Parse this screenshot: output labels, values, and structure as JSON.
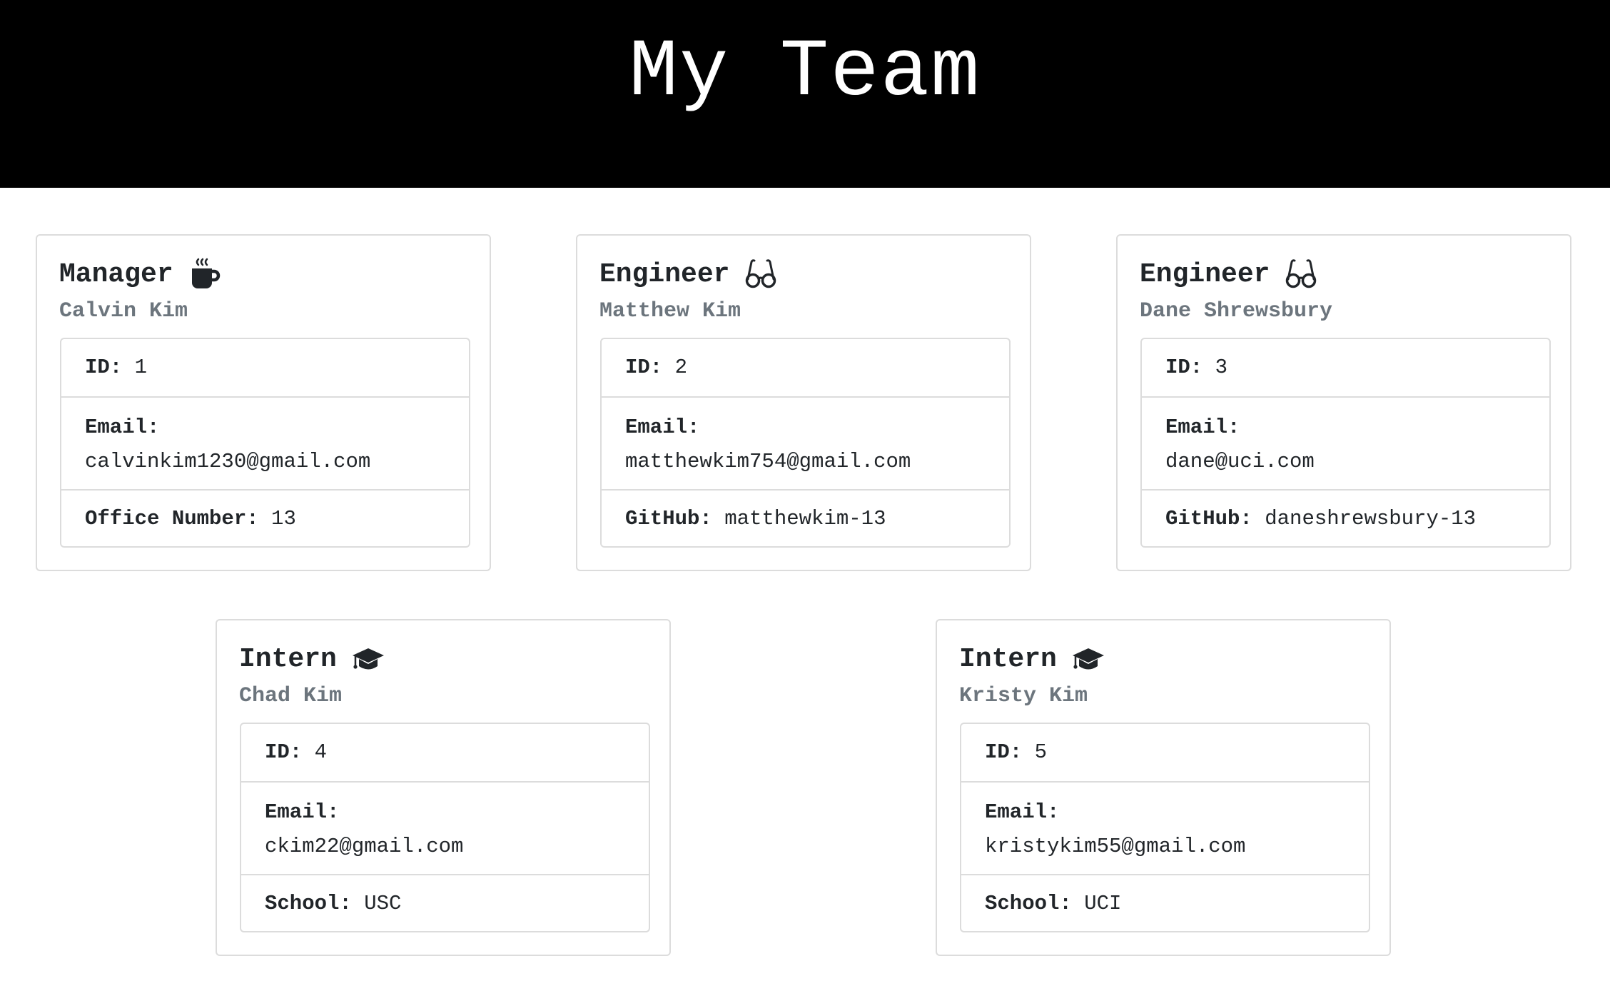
{
  "header": {
    "title": "My Team"
  },
  "cards": [
    {
      "role": "Manager",
      "icon": "coffee-mug-icon",
      "name": "Calvin Kim",
      "id_label": "ID:",
      "id": "1",
      "email_label": "Email:",
      "email": "calvinkim1230@gmail.com",
      "extra_label": "Office Number:",
      "extra": "13"
    },
    {
      "role": "Engineer",
      "icon": "glasses-icon",
      "name": "Matthew Kim",
      "id_label": "ID:",
      "id": "2",
      "email_label": "Email:",
      "email": "matthewkim754@gmail.com",
      "extra_label": "GitHub:",
      "extra": "matthewkim-13"
    },
    {
      "role": "Engineer",
      "icon": "glasses-icon",
      "name": "Dane Shrewsbury",
      "id_label": "ID:",
      "id": "3",
      "email_label": "Email:",
      "email": "dane@uci.com",
      "extra_label": "GitHub:",
      "extra": "daneshrewsbury-13"
    },
    {
      "role": "Intern",
      "icon": "graduation-cap-icon",
      "name": "Chad Kim",
      "id_label": "ID:",
      "id": "4",
      "email_label": "Email:",
      "email": "ckim22@gmail.com",
      "extra_label": "School:",
      "extra": "USC"
    },
    {
      "role": "Intern",
      "icon": "graduation-cap-icon",
      "name": "Kristy Kim",
      "id_label": "ID:",
      "id": "5",
      "email_label": "Email:",
      "email": "kristykim55@gmail.com",
      "extra_label": "School:",
      "extra": "UCI"
    }
  ]
}
